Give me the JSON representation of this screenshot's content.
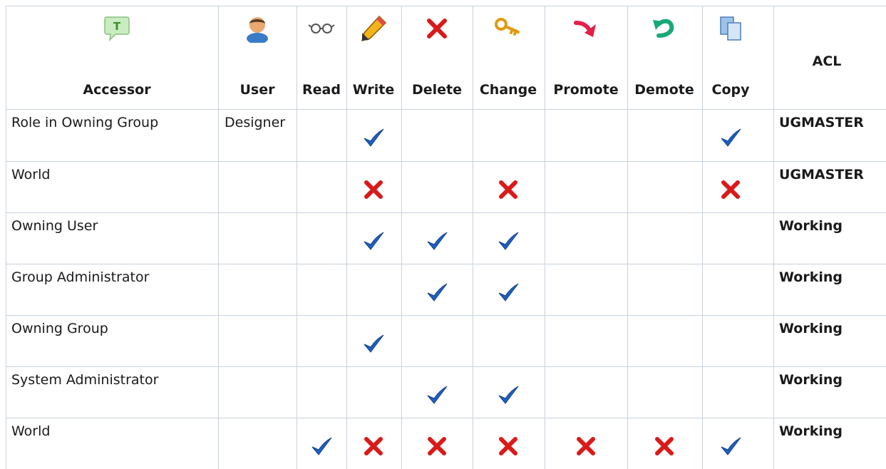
{
  "columns": [
    {
      "key": "accessor",
      "label": "Accessor",
      "icon": "text-balloon-icon"
    },
    {
      "key": "user",
      "label": "User",
      "icon": "user-icon"
    },
    {
      "key": "read",
      "label": "Read",
      "icon": "glasses-icon"
    },
    {
      "key": "write",
      "label": "Write",
      "icon": "pencil-icon"
    },
    {
      "key": "delete",
      "label": "Delete",
      "icon": "red-x-icon"
    },
    {
      "key": "change",
      "label": "Change",
      "icon": "key-icon"
    },
    {
      "key": "promote",
      "label": "Promote",
      "icon": "promote-arrow-icon"
    },
    {
      "key": "demote",
      "label": "Demote",
      "icon": "demote-arrow-icon"
    },
    {
      "key": "copy",
      "label": "Copy",
      "icon": "copy-icon"
    },
    {
      "key": "acl",
      "label": "ACL"
    }
  ],
  "rows": [
    {
      "accessor": "Role in Owning Group",
      "user": "Designer",
      "read": "",
      "write": "grant",
      "delete": "",
      "change": "",
      "promote": "",
      "demote": "",
      "copy": "grant",
      "acl": "UGMASTER"
    },
    {
      "accessor": "World",
      "user": "",
      "read": "",
      "write": "deny",
      "delete": "",
      "change": "deny",
      "promote": "",
      "demote": "",
      "copy": "deny",
      "acl": "UGMASTER"
    },
    {
      "accessor": "Owning User",
      "user": "",
      "read": "",
      "write": "grant",
      "delete": "grant",
      "change": "grant",
      "promote": "",
      "demote": "",
      "copy": "",
      "acl": "Working"
    },
    {
      "accessor": "Group Administrator",
      "user": "",
      "read": "",
      "write": "",
      "delete": "grant",
      "change": "grant",
      "promote": "",
      "demote": "",
      "copy": "",
      "acl": "Working"
    },
    {
      "accessor": "Owning Group",
      "user": "",
      "read": "",
      "write": "grant",
      "delete": "",
      "change": "",
      "promote": "",
      "demote": "",
      "copy": "",
      "acl": "Working"
    },
    {
      "accessor": "System Administrator",
      "user": "",
      "read": "",
      "write": "",
      "delete": "grant",
      "change": "grant",
      "promote": "",
      "demote": "",
      "copy": "",
      "acl": "Working"
    },
    {
      "accessor": "World",
      "user": "",
      "read": "grant",
      "write": "deny",
      "delete": "deny",
      "change": "deny",
      "promote": "deny",
      "demote": "deny",
      "copy": "grant",
      "acl": "Working"
    }
  ],
  "colors": {
    "grid": "#c9d2dc",
    "grant": "#1f5fbf",
    "deny": "#d91a1a"
  }
}
